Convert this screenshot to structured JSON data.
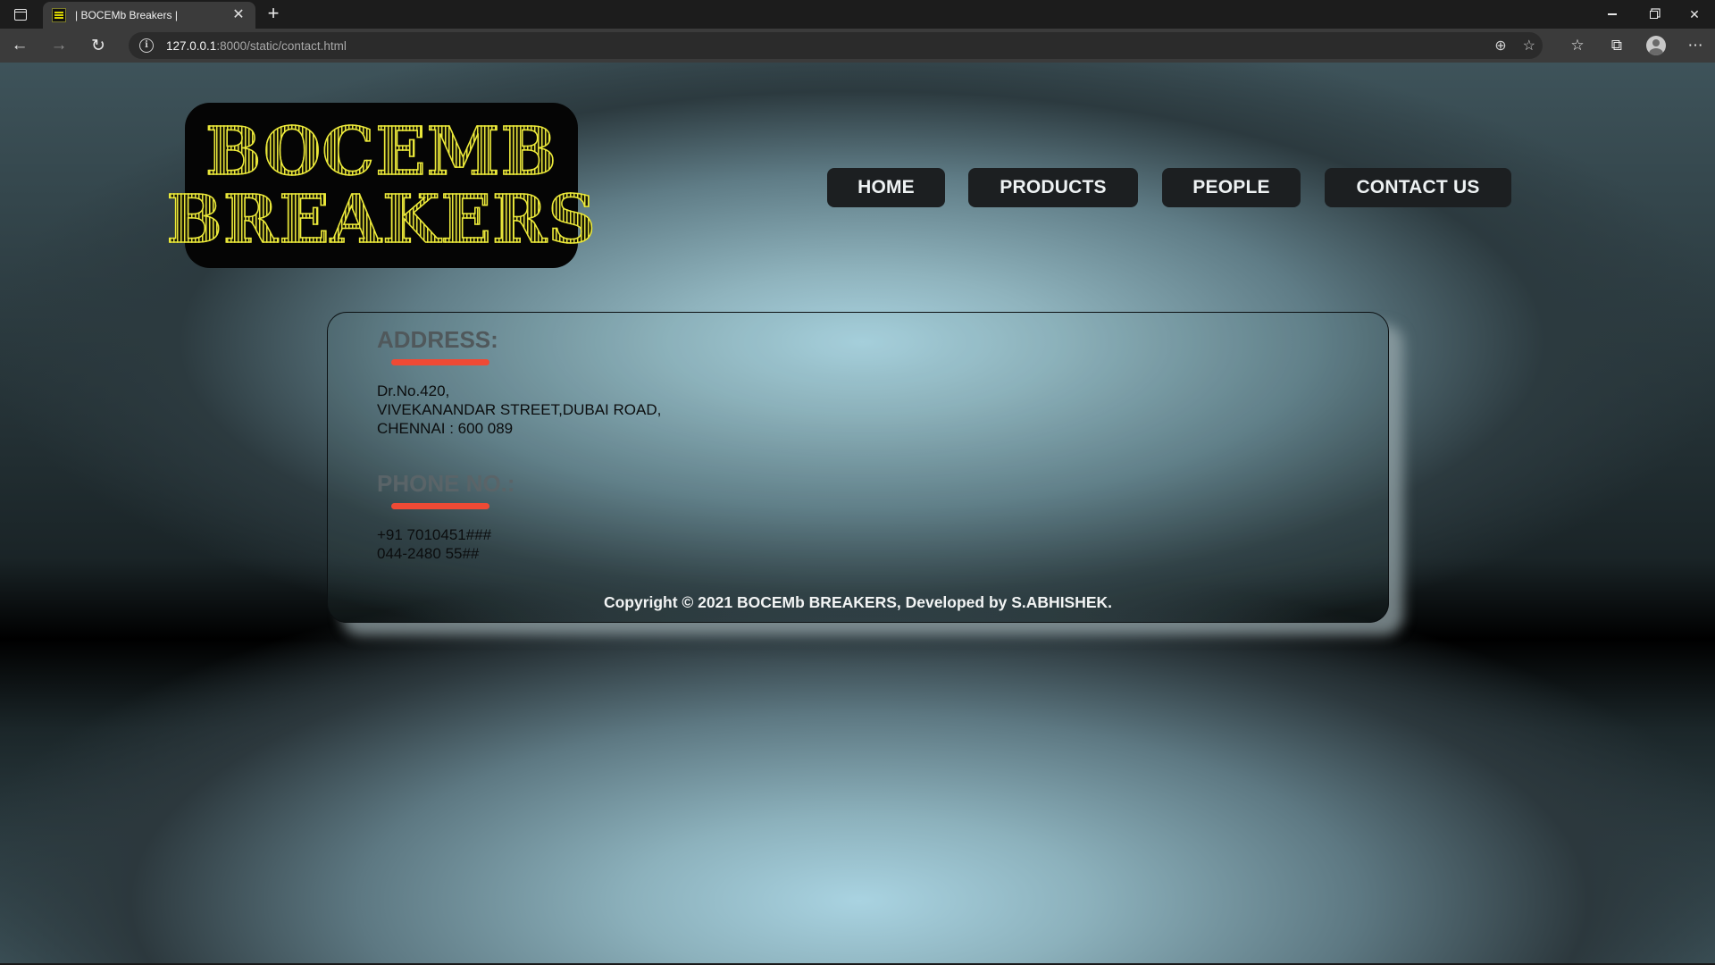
{
  "browser": {
    "tab": {
      "title": "| BOCEMb Breakers |",
      "close_glyph": "✕"
    },
    "new_tab_glyph": "+",
    "url_host": "127.0.0.1",
    "url_rest": ":8000/static/contact.html",
    "window_controls": {
      "minimize": "minimize-icon",
      "restore": "restore-icon",
      "close": "✕"
    }
  },
  "site": {
    "logo": {
      "line1": "BOCEMB",
      "line2": "BREAKERS",
      "color": "#ecea3a"
    },
    "nav": [
      "HOME",
      "PRODUCTS",
      "PEOPLE",
      "CONTACT US"
    ]
  },
  "contact": {
    "address_heading": "ADDRESS:",
    "address_lines": [
      "Dr.No.420,",
      "VIVEKANANDAR STREET,DUBAI ROAD,",
      "CHENNAI : 600 089"
    ],
    "phone_heading": "PHONE NO.:",
    "phone_lines": [
      "+91 7010451###",
      "044-2480 55##"
    ],
    "copyright": "Copyright © 2021 BOCEMb BREAKERS, Developed by S.ABHISHEK."
  },
  "colors": {
    "accent_underline": "#ef4a35",
    "nav_button_bg": "#1c1f21"
  }
}
